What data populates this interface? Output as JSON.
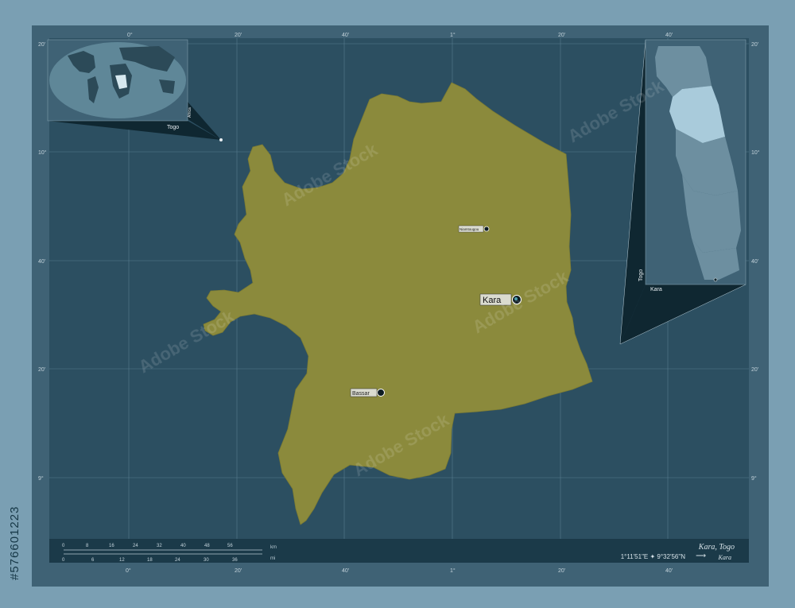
{
  "watermark": "Adobe Stock",
  "stock_id": "#576601223",
  "graticule": {
    "top_labels": [
      "0°",
      "20'",
      "40'",
      "1°",
      "20'",
      "40'"
    ],
    "bottom_labels": [
      "0°",
      "20'",
      "40'",
      "1°",
      "20'",
      "40'"
    ],
    "left_labels": [
      "20'",
      "10°",
      "40'",
      "20'",
      "9°"
    ],
    "right_labels": [
      "20'",
      "10°",
      "40'",
      "20'",
      "9°"
    ]
  },
  "places": {
    "kara": "Kara",
    "bassar": "Bassar",
    "niamtougou": "Niamtougou"
  },
  "inset_world": {
    "country_label": "Togo",
    "continent_label": "Africa"
  },
  "inset_country": {
    "country_label": "Togo",
    "region_label": "Kara"
  },
  "scale_bar": {
    "km_ticks": [
      "0",
      "8",
      "16",
      "24",
      "32",
      "40",
      "48",
      "56"
    ],
    "km_unit": "km",
    "mi_ticks": [
      "0",
      "6",
      "12",
      "18",
      "24",
      "30",
      "36"
    ],
    "mi_unit": "mi"
  },
  "footer": {
    "title": "Kara, Togo",
    "coordinates": "1°11'51\"E ✦ 9°32'56\"N",
    "arrow": "⟶",
    "region": "Kara"
  },
  "colors": {
    "region_fill": "#8b8a3c",
    "water_background": "#2c4f61",
    "frame": "#3f6275",
    "outer": "#7a9fb3",
    "inset_highlight": "#a9cbdb"
  }
}
